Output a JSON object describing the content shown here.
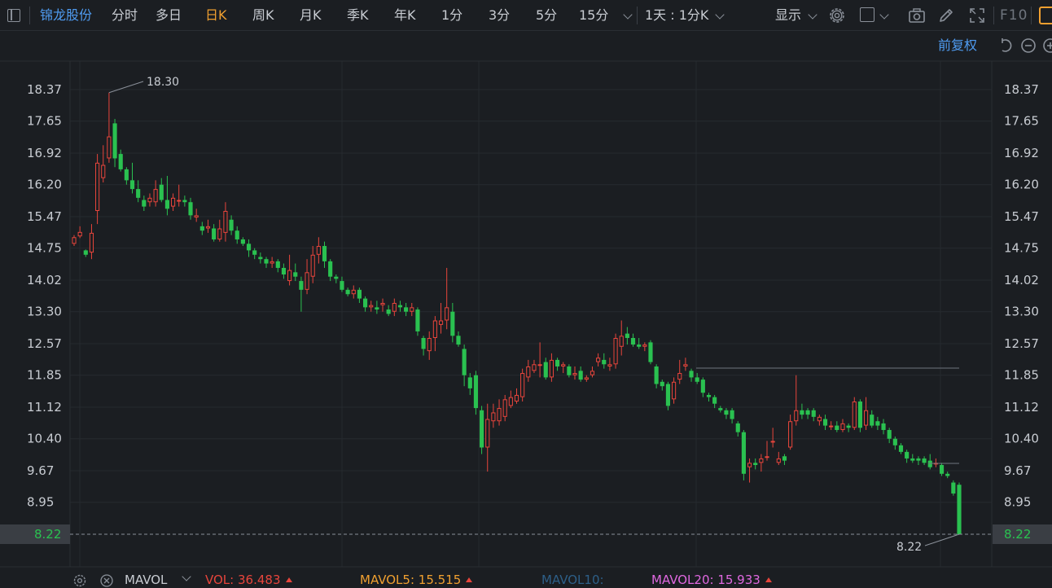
{
  "toolbar": {
    "stock_name": "锦龙股份",
    "periods": [
      "分时",
      "多日",
      "日K",
      "周K",
      "月K",
      "季K",
      "年K",
      "1分",
      "3分",
      "5分",
      "15分"
    ],
    "active_period": "日K",
    "interval_selector": "1天 : 1分K",
    "display_label": "显示",
    "f10_label": "F10",
    "icons": [
      "settings-gear-icon",
      "checkbox-icon",
      "camera-icon",
      "pen-icon",
      "fullscreen-icon"
    ]
  },
  "chart_header": {
    "adjust_label": "前复权",
    "icons": [
      "undo-icon",
      "zoom-out-icon",
      "zoom-in-icon"
    ]
  },
  "chart_data": {
    "type": "candlestick",
    "y_axis_ticks": [
      "18.37",
      "17.65",
      "16.92",
      "16.20",
      "15.47",
      "14.75",
      "14.02",
      "13.30",
      "12.57",
      "11.85",
      "11.12",
      "10.40",
      "9.67",
      "8.95",
      "8.22"
    ],
    "ylim": [
      8.22,
      18.37
    ],
    "high_annotation": "18.30",
    "low_annotation": "8.22",
    "current_price": "8.22",
    "colors": {
      "up": "#e8453c",
      "down": "#2ac150",
      "background": "#1b1e22",
      "grid": "#262a2f",
      "current_price_bg": "#3a3e44"
    },
    "candles": [
      [
        14.85,
        15.0,
        14.8,
        15.05
      ],
      [
        15.02,
        15.12,
        14.98,
        15.25
      ],
      [
        14.7,
        14.6,
        14.55,
        14.72
      ],
      [
        14.65,
        15.1,
        14.5,
        15.3
      ],
      [
        15.6,
        16.7,
        15.3,
        16.9
      ],
      [
        16.35,
        16.65,
        16.25,
        17.1
      ],
      [
        16.8,
        17.3,
        16.7,
        18.3
      ],
      [
        17.6,
        16.8,
        16.6,
        17.7
      ],
      [
        16.9,
        16.55,
        16.5,
        17.0
      ],
      [
        16.55,
        16.3,
        16.2,
        16.6
      ],
      [
        16.3,
        16.1,
        16.0,
        16.7
      ],
      [
        16.1,
        15.9,
        15.8,
        16.3
      ],
      [
        15.85,
        15.7,
        15.6,
        15.95
      ],
      [
        15.8,
        15.9,
        15.7,
        16.0
      ],
      [
        15.8,
        16.1,
        15.7,
        16.3
      ],
      [
        16.2,
        15.85,
        15.8,
        16.35
      ],
      [
        15.85,
        15.65,
        15.5,
        16.4
      ],
      [
        15.7,
        15.9,
        15.6,
        16.0
      ],
      [
        15.85,
        15.85,
        15.7,
        16.2
      ],
      [
        15.85,
        15.8,
        15.7,
        15.95
      ],
      [
        15.8,
        15.5,
        15.4,
        15.9
      ],
      [
        15.45,
        15.5,
        15.35,
        15.65
      ],
      [
        15.25,
        15.15,
        15.05,
        15.35
      ],
      [
        15.2,
        15.25,
        15.1,
        15.4
      ],
      [
        15.2,
        14.95,
        14.9,
        15.3
      ],
      [
        14.95,
        15.2,
        14.9,
        15.4
      ],
      [
        15.1,
        15.6,
        14.9,
        15.8
      ],
      [
        15.4,
        15.15,
        15.05,
        15.5
      ],
      [
        15.15,
        14.95,
        14.85,
        15.25
      ],
      [
        14.95,
        14.85,
        14.8,
        15.0
      ],
      [
        14.85,
        14.7,
        14.55,
        14.95
      ],
      [
        14.7,
        14.6,
        14.5,
        14.75
      ],
      [
        14.55,
        14.5,
        14.4,
        14.65
      ],
      [
        14.5,
        14.4,
        14.3,
        14.55
      ],
      [
        14.4,
        14.45,
        14.3,
        14.55
      ],
      [
        14.45,
        14.3,
        14.2,
        14.5
      ],
      [
        14.3,
        14.15,
        14.05,
        14.4
      ],
      [
        14.0,
        14.25,
        13.9,
        14.6
      ],
      [
        14.2,
        14.1,
        14.0,
        14.4
      ],
      [
        14.0,
        13.8,
        13.3,
        14.1
      ],
      [
        13.8,
        14.2,
        13.7,
        14.5
      ],
      [
        14.1,
        14.6,
        13.95,
        14.8
      ],
      [
        14.6,
        14.8,
        14.4,
        15.0
      ],
      [
        14.8,
        14.45,
        14.3,
        14.9
      ],
      [
        14.45,
        14.1,
        14.0,
        14.5
      ],
      [
        14.1,
        14.05,
        13.95,
        14.15
      ],
      [
        14.0,
        13.8,
        13.75,
        14.1
      ],
      [
        13.8,
        13.7,
        13.65,
        13.85
      ],
      [
        13.7,
        13.8,
        13.6,
        13.9
      ],
      [
        13.8,
        13.6,
        13.5,
        13.85
      ],
      [
        13.6,
        13.4,
        13.3,
        13.65
      ],
      [
        13.4,
        13.45,
        13.3,
        13.55
      ],
      [
        13.4,
        13.35,
        13.25,
        13.55
      ],
      [
        13.45,
        13.5,
        13.3,
        13.6
      ],
      [
        13.35,
        13.25,
        13.2,
        13.45
      ],
      [
        13.3,
        13.5,
        13.2,
        13.6
      ],
      [
        13.45,
        13.4,
        13.3,
        13.55
      ],
      [
        13.4,
        13.3,
        13.2,
        13.5
      ],
      [
        13.3,
        13.4,
        13.2,
        13.5
      ],
      [
        13.35,
        12.85,
        12.75,
        13.4
      ],
      [
        12.7,
        12.45,
        12.3,
        12.75
      ],
      [
        12.4,
        12.7,
        12.2,
        12.85
      ],
      [
        12.7,
        13.1,
        12.4,
        13.2
      ],
      [
        13.0,
        13.1,
        12.8,
        13.5
      ],
      [
        13.1,
        13.4,
        12.9,
        14.3
      ],
      [
        13.3,
        12.75,
        12.6,
        13.5
      ],
      [
        12.75,
        12.55,
        12.5,
        12.85
      ],
      [
        12.45,
        11.85,
        11.6,
        12.55
      ],
      [
        11.8,
        11.55,
        11.4,
        11.9
      ],
      [
        11.85,
        11.1,
        10.95,
        11.95
      ],
      [
        11.05,
        10.2,
        10.05,
        11.15
      ],
      [
        10.2,
        10.85,
        9.65,
        11.2
      ],
      [
        10.8,
        11.0,
        10.65,
        11.2
      ],
      [
        10.8,
        11.1,
        10.7,
        11.3
      ],
      [
        10.9,
        11.3,
        10.8,
        11.4
      ],
      [
        11.15,
        11.35,
        11.1,
        11.5
      ],
      [
        11.25,
        11.4,
        11.2,
        11.55
      ],
      [
        11.35,
        11.9,
        11.25,
        12.0
      ],
      [
        11.8,
        12.05,
        11.7,
        12.2
      ],
      [
        11.95,
        12.1,
        11.9,
        12.2
      ],
      [
        12.1,
        12.1,
        11.8,
        12.6
      ],
      [
        12.15,
        11.8,
        11.75,
        12.25
      ],
      [
        11.8,
        12.2,
        11.7,
        12.35
      ],
      [
        12.2,
        12.05,
        11.95,
        12.25
      ],
      [
        12.05,
        12.1,
        11.9,
        12.15
      ],
      [
        12.05,
        11.85,
        11.8,
        12.1
      ],
      [
        11.85,
        11.9,
        11.75,
        12.05
      ],
      [
        11.95,
        11.75,
        11.7,
        12.05
      ],
      [
        11.75,
        11.8,
        11.7,
        11.85
      ],
      [
        11.85,
        11.95,
        11.8,
        12.05
      ],
      [
        12.15,
        12.25,
        12.05,
        12.35
      ],
      [
        12.2,
        12.1,
        12.0,
        12.35
      ],
      [
        12.05,
        12.1,
        11.95,
        12.25
      ],
      [
        12.1,
        12.7,
        12.0,
        12.8
      ],
      [
        12.5,
        12.75,
        12.3,
        13.1
      ],
      [
        12.8,
        12.7,
        12.55,
        12.95
      ],
      [
        12.7,
        12.55,
        12.5,
        12.8
      ],
      [
        12.55,
        12.5,
        12.45,
        12.7
      ],
      [
        12.5,
        12.55,
        12.4,
        12.6
      ],
      [
        12.6,
        12.15,
        12.1,
        12.65
      ],
      [
        12.05,
        11.65,
        11.55,
        12.1
      ],
      [
        11.7,
        11.6,
        11.5,
        11.75
      ],
      [
        11.65,
        11.15,
        11.05,
        11.7
      ],
      [
        11.3,
        11.7,
        11.2,
        11.8
      ],
      [
        11.75,
        11.9,
        11.65,
        12.2
      ],
      [
        12.05,
        12.1,
        11.95,
        12.25
      ],
      [
        11.95,
        11.8,
        11.7,
        12.0
      ],
      [
        11.8,
        11.7,
        11.65,
        11.9
      ],
      [
        11.75,
        11.45,
        11.35,
        11.8
      ],
      [
        11.4,
        11.35,
        11.25,
        11.45
      ],
      [
        11.35,
        11.2,
        11.1,
        11.4
      ],
      [
        11.1,
        11.05,
        11.0,
        11.15
      ],
      [
        11.05,
        10.95,
        10.85,
        11.1
      ],
      [
        11.05,
        10.85,
        10.75,
        11.1
      ],
      [
        10.75,
        10.55,
        10.45,
        10.8
      ],
      [
        10.55,
        9.6,
        9.45,
        10.6
      ],
      [
        9.75,
        9.85,
        9.4,
        9.95
      ],
      [
        9.85,
        9.8,
        9.7,
        9.95
      ],
      [
        9.85,
        9.95,
        9.65,
        10.05
      ],
      [
        10.0,
        10.0,
        9.9,
        10.35
      ],
      [
        10.35,
        10.35,
        10.2,
        10.65
      ],
      [
        9.85,
        9.95,
        9.8,
        10.1
      ],
      [
        10.0,
        9.9,
        9.8,
        10.05
      ],
      [
        10.2,
        10.8,
        10.15,
        10.95
      ],
      [
        10.8,
        11.05,
        10.7,
        11.85
      ],
      [
        11.05,
        10.95,
        10.85,
        11.2
      ],
      [
        11.05,
        10.95,
        10.85,
        11.1
      ],
      [
        11.05,
        10.9,
        10.8,
        11.1
      ],
      [
        10.8,
        10.9,
        10.7,
        10.95
      ],
      [
        10.85,
        10.7,
        10.6,
        10.95
      ],
      [
        10.7,
        10.7,
        10.6,
        10.8
      ],
      [
        10.7,
        10.6,
        10.55,
        10.8
      ],
      [
        10.6,
        10.75,
        10.55,
        10.85
      ],
      [
        10.7,
        10.65,
        10.55,
        10.75
      ],
      [
        10.65,
        11.25,
        10.6,
        11.35
      ],
      [
        11.25,
        10.65,
        10.55,
        11.3
      ],
      [
        10.7,
        11.05,
        10.6,
        11.35
      ],
      [
        10.95,
        10.7,
        10.65,
        11.05
      ],
      [
        10.8,
        10.7,
        10.6,
        10.9
      ],
      [
        10.75,
        10.6,
        10.5,
        10.85
      ],
      [
        10.6,
        10.4,
        10.3,
        10.65
      ],
      [
        10.4,
        10.25,
        10.15,
        10.45
      ],
      [
        10.25,
        10.1,
        10.05,
        10.3
      ],
      [
        10.1,
        9.95,
        9.85,
        10.15
      ],
      [
        9.95,
        9.9,
        9.85,
        10.05
      ],
      [
        9.95,
        9.9,
        9.8,
        10.0
      ],
      [
        9.95,
        9.85,
        9.8,
        10.0
      ],
      [
        9.9,
        9.75,
        9.7,
        10.05
      ],
      [
        9.85,
        9.85,
        9.75,
        9.95
      ],
      [
        9.8,
        9.6,
        9.55,
        9.85
      ],
      [
        9.6,
        9.55,
        9.5,
        9.65
      ],
      [
        9.4,
        9.15,
        9.1,
        9.45
      ],
      [
        9.35,
        8.22,
        8.22,
        9.4
      ]
    ]
  },
  "indicator_bar": {
    "mavol_label": "MAVOL",
    "vol_label": "VOL:",
    "vol_value": "36.483",
    "mavol5_label": "MAVOL5:",
    "mavol5_value": "15.515",
    "mavol10_label": "MAVOL10:",
    "mavol20_label": "MAVOL20:",
    "mavol20_value": "15.933",
    "colors": {
      "vol": "#e8453c",
      "mavol5": "#f0a030",
      "mavol10": "#2d5f88",
      "mavol20": "#e068e0"
    }
  }
}
